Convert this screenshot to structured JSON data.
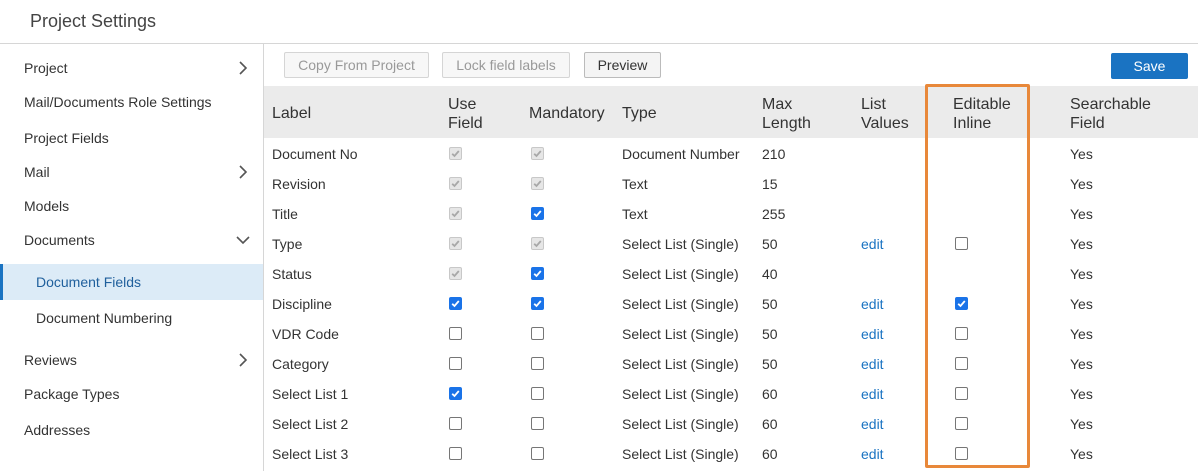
{
  "header": {
    "title": "Project Settings"
  },
  "sidebar": {
    "items": [
      {
        "label": "Project"
      },
      {
        "label": "Mail/Documents Role Settings"
      },
      {
        "label": "Project Fields"
      },
      {
        "label": "Mail"
      },
      {
        "label": "Models"
      },
      {
        "label": "Documents"
      },
      {
        "label": "Document Fields"
      },
      {
        "label": "Document Numbering"
      },
      {
        "label": "Reviews"
      },
      {
        "label": "Package Types"
      },
      {
        "label": "Addresses"
      }
    ]
  },
  "toolbar": {
    "copy_label": "Copy From Project",
    "lock_label": "Lock field labels",
    "preview_label": "Preview",
    "save_label": "Save"
  },
  "table": {
    "headers": {
      "label": "Label",
      "use_field_1": "Use",
      "use_field_2": "Field",
      "mandatory": "Mandatory",
      "type": "Type",
      "max_length_1": "Max",
      "max_length_2": "Length",
      "list_values_1": "List",
      "list_values_2": "Values",
      "editable_1": "Editable",
      "editable_2": "Inline",
      "searchable_1": "Searchable",
      "searchable_2": "Field"
    },
    "rows": [
      {
        "label": "Document No",
        "use_field": "checked-disabled",
        "mandatory": "checked-disabled",
        "type": "Document Number",
        "max_length": "210",
        "list_values": "",
        "editable": "none",
        "searchable": "Yes"
      },
      {
        "label": "Revision",
        "use_field": "checked-disabled",
        "mandatory": "checked-disabled",
        "type": "Text",
        "max_length": "15",
        "list_values": "",
        "editable": "none",
        "searchable": "Yes"
      },
      {
        "label": "Title",
        "use_field": "checked-disabled",
        "mandatory": "checked",
        "type": "Text",
        "max_length": "255",
        "list_values": "",
        "editable": "none",
        "searchable": "Yes"
      },
      {
        "label": "Type",
        "use_field": "checked-disabled",
        "mandatory": "checked-disabled",
        "type": "Select List (Single)",
        "max_length": "50",
        "list_values": "edit",
        "editable": "unchecked",
        "searchable": "Yes"
      },
      {
        "label": "Status",
        "use_field": "checked-disabled",
        "mandatory": "checked",
        "type": "Select List (Single)",
        "max_length": "40",
        "list_values": "",
        "editable": "none",
        "searchable": "Yes"
      },
      {
        "label": "Discipline",
        "use_field": "checked",
        "mandatory": "checked",
        "type": "Select List (Single)",
        "max_length": "50",
        "list_values": "edit",
        "editable": "checked",
        "searchable": "Yes"
      },
      {
        "label": "VDR Code",
        "use_field": "unchecked",
        "mandatory": "unchecked",
        "type": "Select List (Single)",
        "max_length": "50",
        "list_values": "edit",
        "editable": "unchecked",
        "searchable": "Yes"
      },
      {
        "label": "Category",
        "use_field": "unchecked",
        "mandatory": "unchecked",
        "type": "Select List (Single)",
        "max_length": "50",
        "list_values": "edit",
        "editable": "unchecked",
        "searchable": "Yes"
      },
      {
        "label": "Select List 1",
        "use_field": "checked",
        "mandatory": "unchecked",
        "type": "Select List (Single)",
        "max_length": "60",
        "list_values": "edit",
        "editable": "unchecked",
        "searchable": "Yes"
      },
      {
        "label": "Select List 2",
        "use_field": "unchecked",
        "mandatory": "unchecked",
        "type": "Select List (Single)",
        "max_length": "60",
        "list_values": "edit",
        "editable": "unchecked",
        "searchable": "Yes"
      },
      {
        "label": "Select List 3",
        "use_field": "unchecked",
        "mandatory": "unchecked",
        "type": "Select List (Single)",
        "max_length": "60",
        "list_values": "edit",
        "editable": "unchecked",
        "searchable": "Yes"
      }
    ]
  },
  "colors": {
    "accent": "#1a73c2",
    "highlight": "#e8883a",
    "active_bg": "#dcebf7"
  }
}
